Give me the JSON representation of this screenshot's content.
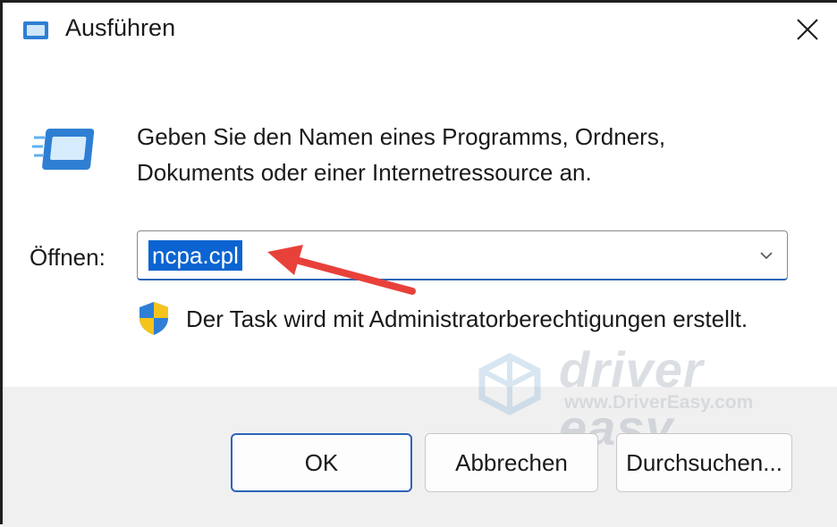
{
  "window": {
    "title": "Ausführen",
    "close_glyph": "✕",
    "icon": "run-dialog-icon"
  },
  "dialog": {
    "description_line1": "Geben Sie den Namen eines Programms, Ordners,",
    "description_line2": "Dokuments oder einer Internetressource an.",
    "open_label": "Öffnen:",
    "open_value": "ncpa.cpl",
    "admin_notice": "Der Task wird mit Administratorberechtigungen erstellt."
  },
  "buttons": {
    "ok": "OK",
    "cancel": "Abbrechen",
    "browse": "Durchsuchen..."
  },
  "watermark": {
    "brand": "driver easy",
    "url": "www.DriverEasy.com"
  },
  "colors": {
    "accent": "#0b64d1",
    "annotation_arrow": "#e8413a",
    "footer_bg": "#f0f0f0"
  }
}
